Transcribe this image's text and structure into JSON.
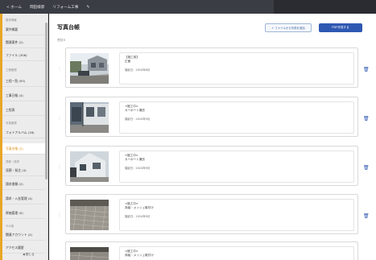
{
  "header": {
    "back_label": "< ホーム",
    "client_name": "岡田様邸",
    "project_name": "リフォーム工事",
    "edit_icon": "pencil-icon"
  },
  "sidebar": {
    "sections": [
      {
        "label": "基本情報"
      },
      {
        "label": "工程管理"
      },
      {
        "label": "写真管理"
      },
      {
        "label": "見積・請求"
      },
      {
        "label": "その他"
      }
    ],
    "items": [
      {
        "label": "案件概要"
      },
      {
        "label": "関連案件 (2)"
      },
      {
        "label": "ファイル (306)"
      },
      {
        "label": "工程一覧 (93)"
      },
      {
        "label": "工事日報 (4)"
      },
      {
        "label": "工程表"
      },
      {
        "label": "フォトアルバム (16)"
      },
      {
        "label": "写真台帳 (2)"
      },
      {
        "label": "見積・発注 (4)"
      },
      {
        "label": "請求書類 (2)"
      },
      {
        "label": "請求・入金管理 (4)"
      },
      {
        "label": "原価管理 (0)"
      },
      {
        "label": "関連アカウント (2)"
      },
      {
        "label": "アクセス履歴"
      }
    ],
    "collapse_label": "◀ 閉じる"
  },
  "main": {
    "title": "写真台帳",
    "count_label": "合計5",
    "export_button": "+ ファイルから写真を追加",
    "add_button": "PDF作成する",
    "cards": [
      {
        "title": "【施工前】",
        "subtitle": "正面",
        "date": "撮影日：2024年8月"
      },
      {
        "title": "<施工中>",
        "subtitle": "カーポート撤去",
        "date": "撮影日：2024年9月"
      },
      {
        "title": "<施工中>",
        "subtitle": "カーポート撤去",
        "date": "撮影日：2024年9月"
      },
      {
        "title": "<施工中>",
        "subtitle": "床組・メッシュ取付け",
        "date": "撮影日：2024年9月"
      },
      {
        "title": "<施工中>",
        "subtitle": "床組・メッシュ取付け",
        "date": ""
      }
    ]
  },
  "colors": {
    "accent": "#e9a626",
    "primary": "#2f58b2",
    "header_bg": "#3b3d45"
  }
}
